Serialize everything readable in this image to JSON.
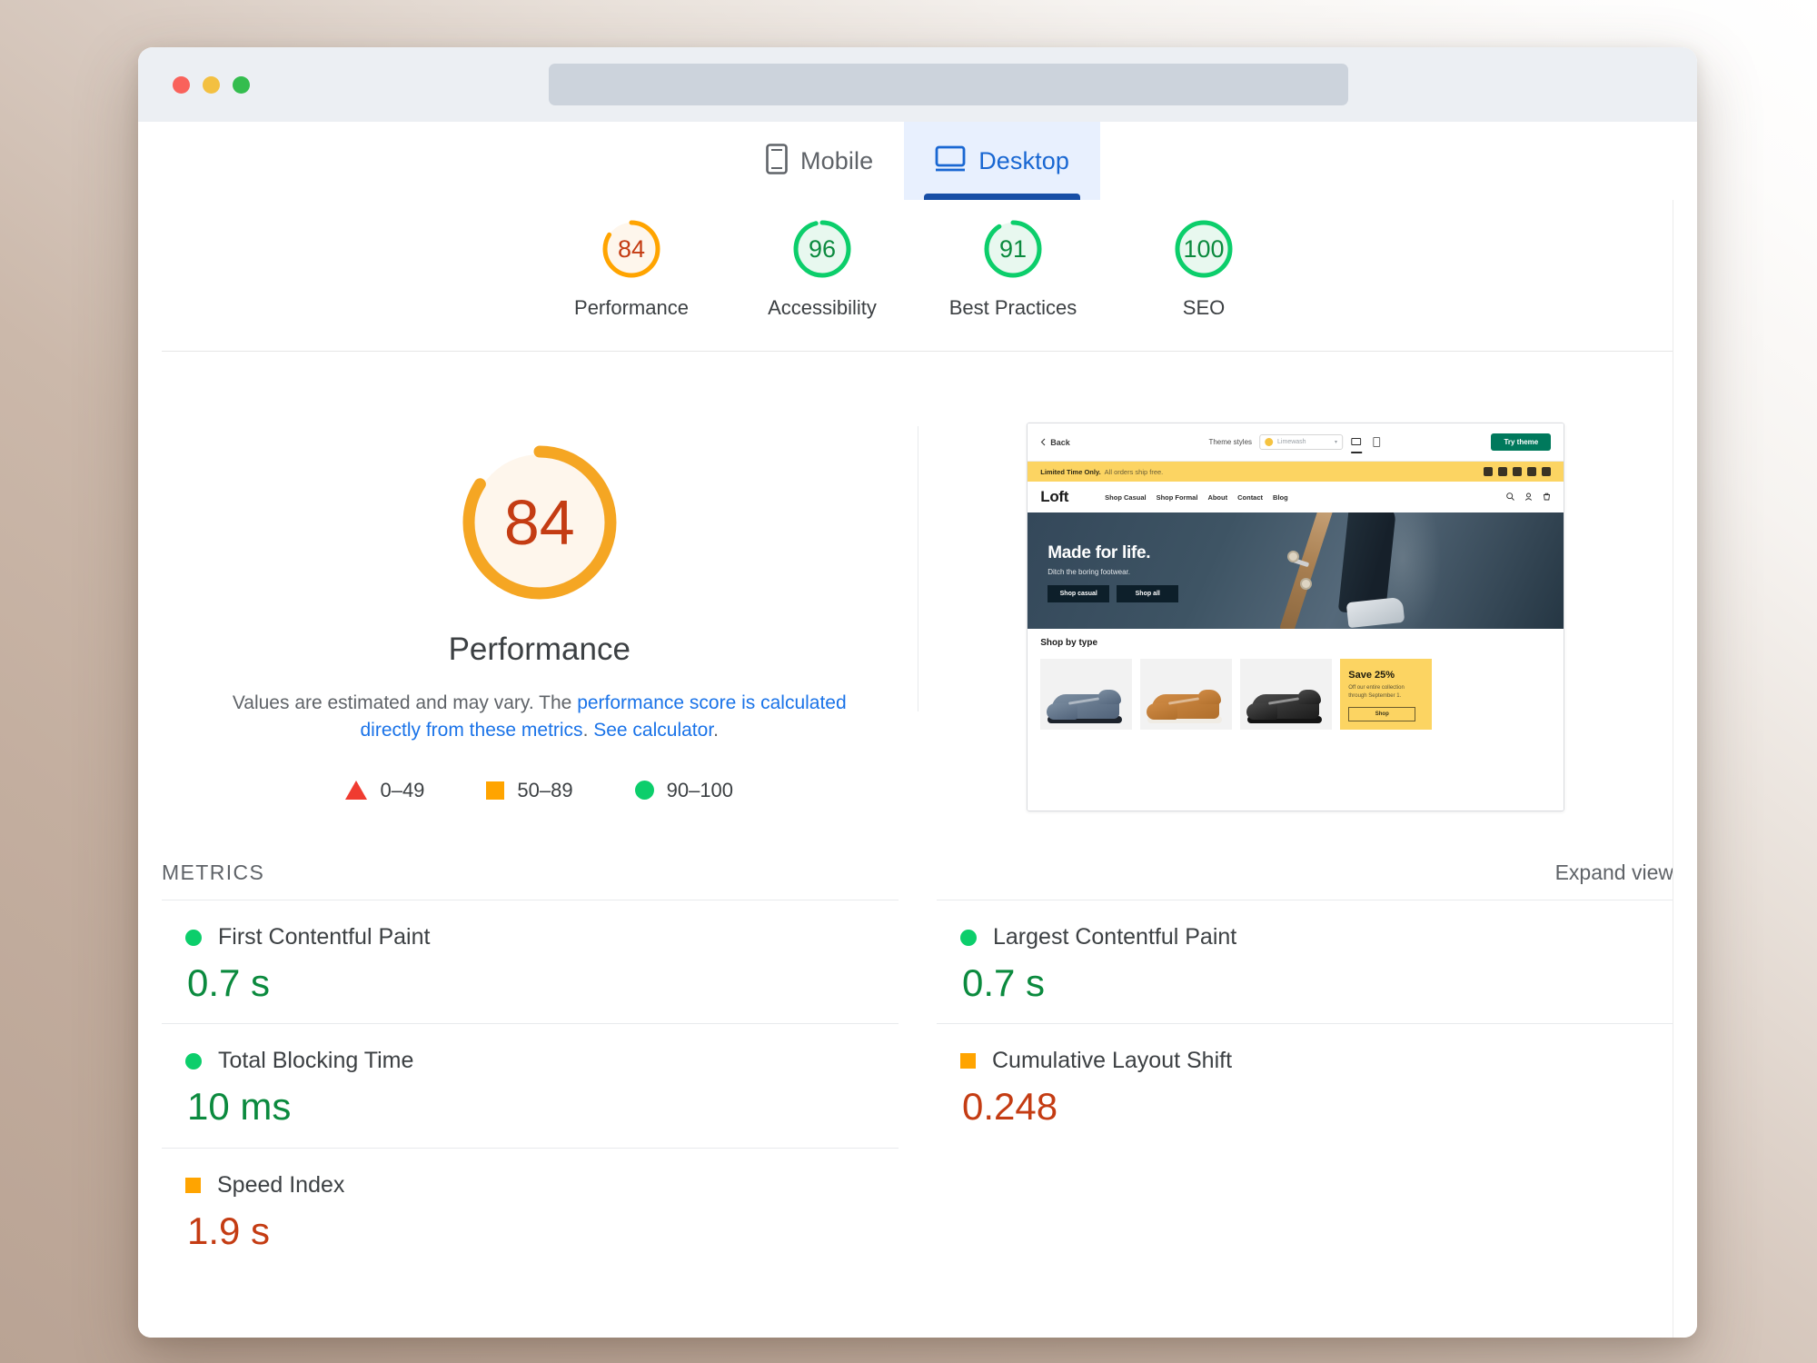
{
  "browser": {
    "traffic_lights": [
      "close",
      "minimize",
      "zoom"
    ],
    "url_value": "",
    "url_placeholder": ""
  },
  "device_tabs": [
    {
      "id": "mobile",
      "label": "Mobile",
      "icon": "mobile-icon",
      "active": false
    },
    {
      "id": "desktop",
      "label": "Desktop",
      "icon": "desktop-icon",
      "active": true
    }
  ],
  "score_summary": [
    {
      "label": "Performance",
      "value": "84",
      "percent": 84,
      "tier": "average"
    },
    {
      "label": "Accessibility",
      "value": "96",
      "percent": 96,
      "tier": "good"
    },
    {
      "label": "Best Practices",
      "value": "91",
      "percent": 91,
      "tier": "good"
    },
    {
      "label": "SEO",
      "value": "100",
      "percent": 100,
      "tier": "good"
    }
  ],
  "category_report": {
    "score": "84",
    "percent": 84,
    "title": "Performance",
    "disclaimer_pre": "Values are estimated and may vary. The ",
    "disclaimer_link1": "performance score is calculated directly from these metrics",
    "disclaimer_mid": ". ",
    "disclaimer_link2": "See calculator",
    "disclaimer_post": "."
  },
  "legend": [
    {
      "shape": "triangle",
      "label": "0–49",
      "color": "#f03b30"
    },
    {
      "shape": "square",
      "label": "50–89",
      "color": "#ffa400"
    },
    {
      "shape": "circle",
      "label": "90–100",
      "color": "#0cce6b"
    }
  ],
  "metrics_section": {
    "title": "METRICS",
    "expand_label": "Expand view"
  },
  "metrics": [
    {
      "name": "First Contentful Paint",
      "value": "0.7 s",
      "shape": "circle",
      "value_class": "val-green"
    },
    {
      "name": "Largest Contentful Paint",
      "value": "0.7 s",
      "shape": "circle",
      "value_class": "val-green"
    },
    {
      "name": "Total Blocking Time",
      "value": "10 ms",
      "shape": "circle",
      "value_class": "val-green"
    },
    {
      "name": "Cumulative Layout Shift",
      "value": "0.248",
      "shape": "square",
      "value_class": "val-orange"
    },
    {
      "name": "Speed Index",
      "value": "1.9 s",
      "shape": "square",
      "value_class": "val-orange"
    }
  ],
  "site_thumbnail": {
    "editor_bar": {
      "back_label": "Back",
      "style_label": "Theme styles",
      "style_value": "Limewash",
      "try_label": "Try theme",
      "devices": [
        "desktop-preview-icon",
        "mobile-preview-icon"
      ]
    },
    "announcement": {
      "headline": "Limited Time Only.",
      "sub": "All orders ship free.",
      "social_icons": [
        "facebook-icon",
        "instagram-icon",
        "youtube-icon",
        "twitter-icon",
        "pinterest-icon"
      ]
    },
    "store_nav": {
      "logo": "Loft",
      "menu": [
        "Shop Casual",
        "Shop Formal",
        "About",
        "Contact",
        "Blog"
      ],
      "icons": [
        "search-icon",
        "account-icon",
        "cart-icon"
      ]
    },
    "hero": {
      "title": "Made for life.",
      "subtitle": "Ditch the boring footwear.",
      "buttons": [
        "Shop casual",
        "Shop all"
      ]
    },
    "shop_section": {
      "title": "Shop by type",
      "cards": [
        {
          "type": "product",
          "style": "shoe-blue"
        },
        {
          "type": "product",
          "style": "shoe-tan"
        },
        {
          "type": "product",
          "style": "shoe-black"
        }
      ],
      "promo": {
        "title": "Save 25%",
        "sub": "Off our entire collection through September 1.",
        "button": "Shop"
      }
    }
  },
  "colors": {
    "good": "#0cce6b",
    "average": "#ffa400",
    "poor": "#f03b30",
    "accent_blue": "#1a73e8",
    "active_tab_blue": "#1967d2",
    "active_tab_bg": "#e8f0fe"
  }
}
